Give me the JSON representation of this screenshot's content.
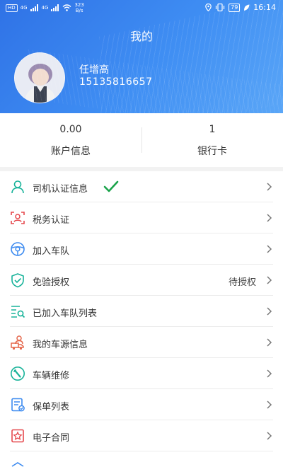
{
  "status_bar": {
    "sim1": "HD",
    "sim2": "HD",
    "signal1": "4G",
    "signal2": "4G",
    "net_speed_value": "323",
    "net_speed_unit": "B/s",
    "battery": "79",
    "time": "16:14"
  },
  "header": {
    "title": "我的",
    "user_name": "任增高",
    "user_phone": "15135816657"
  },
  "stats": [
    {
      "value": "0.00",
      "label": "账户信息"
    },
    {
      "value": "1",
      "label": "银行卡"
    }
  ],
  "menu": [
    {
      "label": "司机认证信息",
      "icon": "user-icon",
      "verified": true
    },
    {
      "label": "税务认证",
      "icon": "face-scan-icon"
    },
    {
      "label": "加入车队",
      "icon": "steering-wheel-icon"
    },
    {
      "label": "免验授权",
      "icon": "shield-check-icon",
      "value": "待授权"
    },
    {
      "label": "已加入车队列表",
      "icon": "list-search-icon"
    },
    {
      "label": "我的车源信息",
      "icon": "truck-source-icon"
    },
    {
      "label": "车辆维修",
      "icon": "wrench-icon"
    },
    {
      "label": "保单列表",
      "icon": "policy-icon"
    },
    {
      "label": "电子合同",
      "icon": "contract-icon"
    }
  ],
  "colors": {
    "header_blue": "#3a84ef",
    "icon_teal": "#19b39a",
    "icon_red": "#e5484d",
    "icon_blue": "#3d8bf0",
    "check_green": "#1aa34a"
  }
}
